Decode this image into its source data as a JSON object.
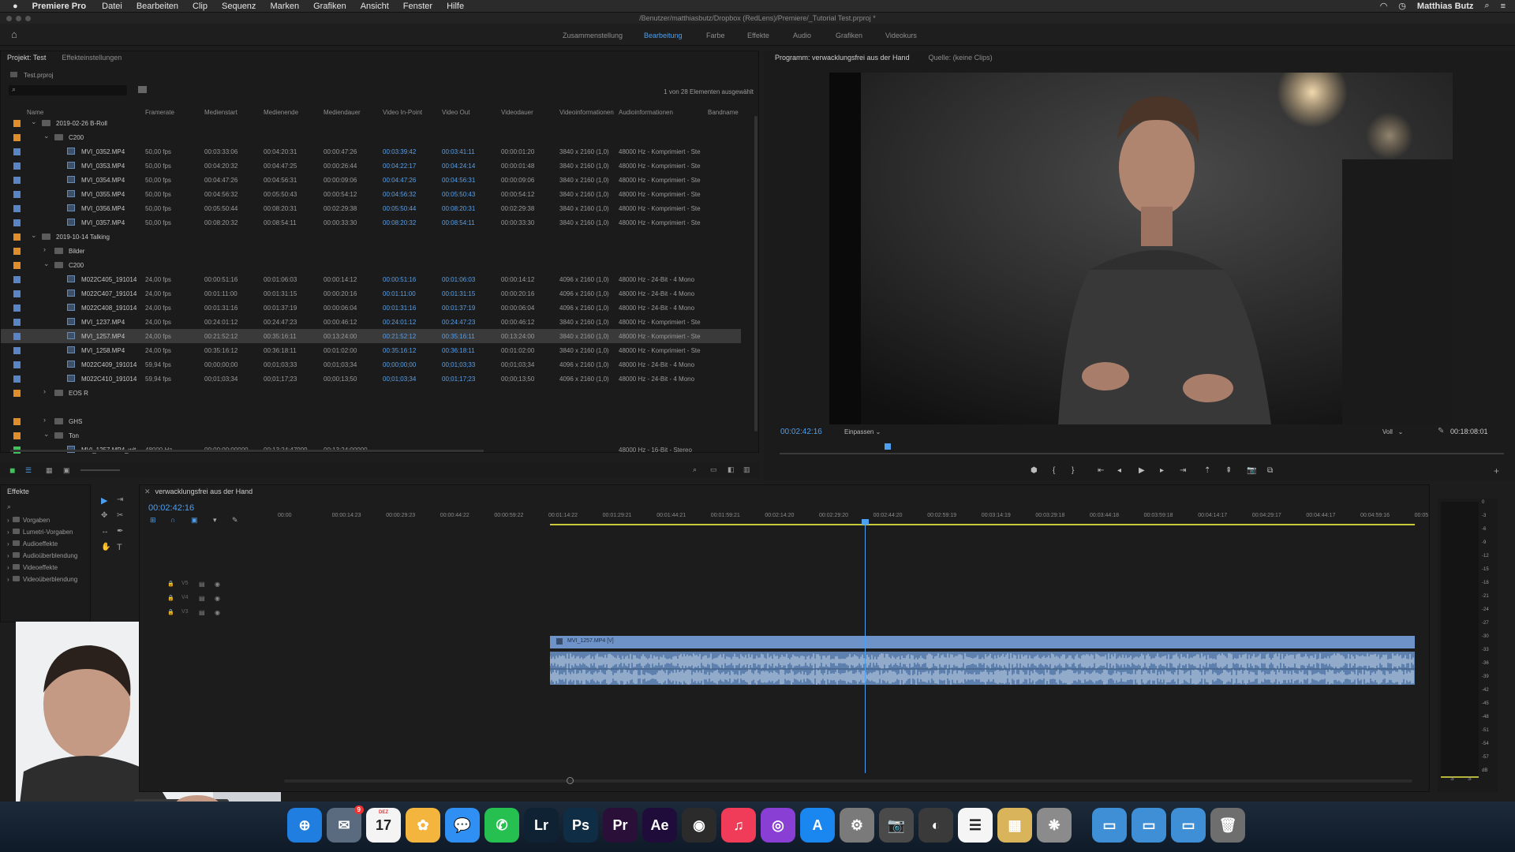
{
  "menubar": {
    "apple": "",
    "app": "Premiere Pro",
    "items": [
      "Datei",
      "Bearbeiten",
      "Clip",
      "Sequenz",
      "Marken",
      "Grafiken",
      "Ansicht",
      "Fenster",
      "Hilfe"
    ],
    "user": "Matthias Butz"
  },
  "title": "/Benutzer/matthiasbutz/Dropbox (RedLens)/Premiere/_Tutorial Test.prproj *",
  "workspaces": [
    {
      "label": "Zusammenstellung"
    },
    {
      "label": "Bearbeitung",
      "active": true
    },
    {
      "label": "Farbe"
    },
    {
      "label": "Effekte"
    },
    {
      "label": "Audio"
    },
    {
      "label": "Grafiken"
    },
    {
      "label": "Videokurs"
    }
  ],
  "project": {
    "tab1": "Projekt: Test",
    "tab2": "Effekteinstellungen",
    "file": "Test.prproj",
    "count": "1 von 28 Elementen ausgewählt",
    "columns": [
      "Name",
      "Framerate",
      "Medienstart",
      "Medienende",
      "Mediendauer",
      "Video In-Point",
      "Video Out",
      "Videodauer",
      "Videoinformationen",
      "Audioinformationen",
      "Bandname"
    ],
    "rows": [
      {
        "type": "folder",
        "indent": 0,
        "open": true,
        "color": "#e08e2c",
        "name": "2019-02-26 B-Roll"
      },
      {
        "type": "folder",
        "indent": 1,
        "open": true,
        "color": "#e08e2c",
        "name": "C200"
      },
      {
        "type": "clip",
        "indent": 2,
        "color": "#5a84c4",
        "name": "MVI_0352.MP4",
        "c": [
          "50,00 fps",
          "00:03:33:06",
          "00:04:20:31",
          "00:00:47:26",
          "00:03:39:42",
          "00:03:41:11",
          "00:00:01:20",
          "3840 x 2160 (1,0)",
          "48000 Hz - Komprimiert - Ste"
        ]
      },
      {
        "type": "clip",
        "indent": 2,
        "color": "#5a84c4",
        "name": "MVI_0353.MP4",
        "c": [
          "50,00 fps",
          "00:04:20:32",
          "00:04:47:25",
          "00:00:26:44",
          "00:04:22:17",
          "00:04:24:14",
          "00:00:01:48",
          "3840 x 2160 (1,0)",
          "48000 Hz - Komprimiert - Ste"
        ]
      },
      {
        "type": "clip",
        "indent": 2,
        "color": "#5a84c4",
        "name": "MVI_0354.MP4",
        "c": [
          "50,00 fps",
          "00:04:47:26",
          "00:04:56:31",
          "00:00:09:06",
          "00:04:47:26",
          "00:04:56:31",
          "00:00:09:06",
          "3840 x 2160 (1,0)",
          "48000 Hz - Komprimiert - Ste"
        ]
      },
      {
        "type": "clip",
        "indent": 2,
        "color": "#5a84c4",
        "name": "MVI_0355.MP4",
        "c": [
          "50,00 fps",
          "00:04:56:32",
          "00:05:50:43",
          "00:00:54:12",
          "00:04:56:32",
          "00:05:50:43",
          "00:00:54:12",
          "3840 x 2160 (1,0)",
          "48000 Hz - Komprimiert - Ste"
        ]
      },
      {
        "type": "clip",
        "indent": 2,
        "color": "#5a84c4",
        "name": "MVI_0356.MP4",
        "c": [
          "50,00 fps",
          "00:05:50:44",
          "00:08:20:31",
          "00:02:29:38",
          "00:05:50:44",
          "00:08:20:31",
          "00:02:29:38",
          "3840 x 2160 (1,0)",
          "48000 Hz - Komprimiert - Ste"
        ]
      },
      {
        "type": "clip",
        "indent": 2,
        "color": "#5a84c4",
        "name": "MVI_0357.MP4",
        "c": [
          "50,00 fps",
          "00:08:20:32",
          "00:08:54:11",
          "00:00:33:30",
          "00:08:20:32",
          "00:08:54:11",
          "00:00:33:30",
          "3840 x 2160 (1,0)",
          "48000 Hz - Komprimiert - Ste"
        ]
      },
      {
        "type": "folder",
        "indent": 0,
        "open": true,
        "color": "#e08e2c",
        "name": "2019-10-14 Talking"
      },
      {
        "type": "folder",
        "indent": 1,
        "open": false,
        "color": "#e08e2c",
        "name": "Bilder"
      },
      {
        "type": "folder",
        "indent": 1,
        "open": true,
        "color": "#e08e2c",
        "name": "C200"
      },
      {
        "type": "clip",
        "indent": 2,
        "color": "#5a84c4",
        "name": "M022C405_191014",
        "c": [
          "24,00 fps",
          "00:00:51:16",
          "00:01:06:03",
          "00:00:14:12",
          "00:00:51:16",
          "00:01:06:03",
          "00:00:14:12",
          "4096 x 2160 (1,0)",
          "48000 Hz - 24-Bit - 4 Mono"
        ]
      },
      {
        "type": "clip",
        "indent": 2,
        "color": "#5a84c4",
        "name": "M022C407_191014",
        "c": [
          "24,00 fps",
          "00:01:11:00",
          "00:01:31:15",
          "00:00:20:16",
          "00:01:11:00",
          "00:01:31:15",
          "00:00:20:16",
          "4096 x 2160 (1,0)",
          "48000 Hz - 24-Bit - 4 Mono"
        ]
      },
      {
        "type": "clip",
        "indent": 2,
        "color": "#5a84c4",
        "name": "M022C408_191014",
        "c": [
          "24,00 fps",
          "00:01:31:16",
          "00:01:37:19",
          "00:00:06:04",
          "00:01:31:16",
          "00:01:37:19",
          "00:00:06:04",
          "4096 x 2160 (1,0)",
          "48000 Hz - 24-Bit - 4 Mono"
        ]
      },
      {
        "type": "clip",
        "indent": 2,
        "color": "#5a84c4",
        "name": "MVI_1237.MP4",
        "c": [
          "24,00 fps",
          "00:24:01:12",
          "00:24:47:23",
          "00:00:46:12",
          "00:24:01:12",
          "00:24:47:23",
          "00:00:46:12",
          "3840 x 2160 (1,0)",
          "48000 Hz - Komprimiert - Ste"
        ]
      },
      {
        "type": "clip",
        "indent": 2,
        "color": "#5a84c4",
        "name": "MVI_1257.MP4",
        "selected": true,
        "c": [
          "24,00 fps",
          "00:21:52:12",
          "00:35:16:11",
          "00:13:24:00",
          "00:21:52:12",
          "00:35:16:11",
          "00:13:24:00",
          "3840 x 2160 (1,0)",
          "48000 Hz - Komprimiert - Ste"
        ]
      },
      {
        "type": "clip",
        "indent": 2,
        "color": "#5a84c4",
        "name": "MVI_1258.MP4",
        "c": [
          "24,00 fps",
          "00:35:16:12",
          "00:36:18:11",
          "00:01:02:00",
          "00:35:16:12",
          "00:36:18:11",
          "00:01:02:00",
          "3840 x 2160 (1,0)",
          "48000 Hz - Komprimiert - Ste"
        ]
      },
      {
        "type": "clip",
        "indent": 2,
        "color": "#5a84c4",
        "name": "M022C409_191014",
        "c": [
          "59,94 fps",
          "00;00;00;00",
          "00;01;03;33",
          "00;01;03;34",
          "00;00;00;00",
          "00;01;03;33",
          "00;01;03;34",
          "4096 x 2160 (1,0)",
          "48000 Hz - 24-Bit - 4 Mono"
        ]
      },
      {
        "type": "clip",
        "indent": 2,
        "color": "#5a84c4",
        "name": "M022C410_191014",
        "c": [
          "59,94 fps",
          "00;01;03;34",
          "00;01;17;23",
          "00;00;13;50",
          "00;01;03;34",
          "00;01;17;23",
          "00;00;13;50",
          "4096 x 2160 (1,0)",
          "48000 Hz - 24-Bit - 4 Mono"
        ]
      },
      {
        "type": "folder",
        "indent": 1,
        "open": false,
        "color": "#e08e2c",
        "name": "EOS R"
      },
      {
        "type": "folder",
        "indent": 1,
        "open": false,
        "color": "#e08e2c",
        "name": "GHS"
      },
      {
        "type": "folder",
        "indent": 1,
        "open": true,
        "color": "#e08e2c",
        "name": "Ton"
      },
      {
        "type": "audio",
        "indent": 2,
        "color": "#3fc35a",
        "name": "MVI_1257.MP4_wit",
        "c": [
          "48000  Hz",
          "00:00:00:00000",
          "00:13:24:47999",
          "00:13:24:00000",
          "",
          "",
          "",
          "",
          "48000 Hz - 16-Bit - Stereo"
        ]
      }
    ]
  },
  "program": {
    "tab": "Programm: verwacklungsfrei aus der Hand",
    "source": "Quelle: (keine Clips)",
    "timecode": "00:02:42:16",
    "fit": "Einpassen",
    "quality": "Voll",
    "duration": "00:18:08:01",
    "playhead": 0.149
  },
  "effects": {
    "tab": "Effekte",
    "items": [
      "Vorgaben",
      "Lumetri-Vorgaben",
      "Audioeffekte",
      "Audioüberblendung",
      "Videoeffekte",
      "Videoüberblendung"
    ]
  },
  "timeline": {
    "tab": "verwacklungsfrei aus der Hand",
    "timecode": "00:02:42:16",
    "ruler": [
      "00:00",
      "00:00:14:23",
      "00:00:29:23",
      "00:00:44:22",
      "00:00:59:22",
      "00:01:14:22",
      "00:01:29:21",
      "00:01:44:21",
      "00:01:59:21",
      "00:02:14:20",
      "00:02:29:20",
      "00:02:44:20",
      "00:02:59:19",
      "00:03:14:19",
      "00:03:29:18",
      "00:03:44:18",
      "00:03:59:18",
      "00:04:14:17",
      "00:04:29:17",
      "00:04:44:17",
      "00:04:59:16",
      "00:05"
    ],
    "tracks": [
      "V5",
      "V4",
      "V3"
    ],
    "clip_label": "MVI_1257.MP4 [V]"
  },
  "meter": {
    "scale": [
      "0",
      "-3",
      "-6",
      "-9",
      "-12",
      "-15",
      "-18",
      "-21",
      "-24",
      "-27",
      "-30",
      "-33",
      "-36",
      "-39",
      "-42",
      "-45",
      "-48",
      "-51",
      "-54",
      "-57",
      "dB"
    ],
    "bottom": [
      "S",
      "S"
    ]
  },
  "dock": [
    {
      "name": "safari",
      "label": "⊕",
      "color": "#1f7ee0"
    },
    {
      "name": "mail",
      "label": "✉",
      "color": "#5a6b80",
      "badge": "9"
    },
    {
      "name": "calendar",
      "label": "17",
      "color": "#f4f4f4",
      "top": "DEZ"
    },
    {
      "name": "photos",
      "label": "✿",
      "color": "#f3b53d"
    },
    {
      "name": "messages",
      "label": "💬",
      "color": "#2f8ff2"
    },
    {
      "name": "whatsapp",
      "label": "✆",
      "color": "#25c050"
    },
    {
      "name": "lightroom",
      "label": "Lr",
      "color": "#0f2233"
    },
    {
      "name": "photoshop",
      "label": "Ps",
      "color": "#0f2d44"
    },
    {
      "name": "premiere",
      "label": "Pr",
      "color": "#2a0f38"
    },
    {
      "name": "after-effects",
      "label": "Ae",
      "color": "#1f0c3a"
    },
    {
      "name": "davinci",
      "label": "◉",
      "color": "#2b2b2b"
    },
    {
      "name": "music",
      "label": "♫",
      "color": "#f03c58"
    },
    {
      "name": "podcasts",
      "label": "◎",
      "color": "#8a3fd4"
    },
    {
      "name": "app-store",
      "label": "A",
      "color": "#1a86f0"
    },
    {
      "name": "system-prefs",
      "label": "⚙",
      "color": "#7a7a7a"
    },
    {
      "name": "screenshot",
      "label": "📷",
      "color": "#4a4a4a"
    },
    {
      "name": "compressor",
      "label": "◐",
      "color": "#3a3a3a"
    },
    {
      "name": "reminders",
      "label": "☰",
      "color": "#f5f5f5"
    },
    {
      "name": "archive",
      "label": "▦",
      "color": "#d9b45a"
    },
    {
      "name": "color-finale",
      "label": "❋",
      "color": "#8b8b8b"
    },
    {
      "name": "folder-apps",
      "label": "▭",
      "color": "#3f8fd6"
    },
    {
      "name": "folder-docs",
      "label": "▭",
      "color": "#3f8fd6"
    },
    {
      "name": "folder-downloads",
      "label": "▭",
      "color": "#3f8fd6"
    },
    {
      "name": "trash",
      "label": "🗑",
      "color": "#6e6e6e"
    }
  ]
}
